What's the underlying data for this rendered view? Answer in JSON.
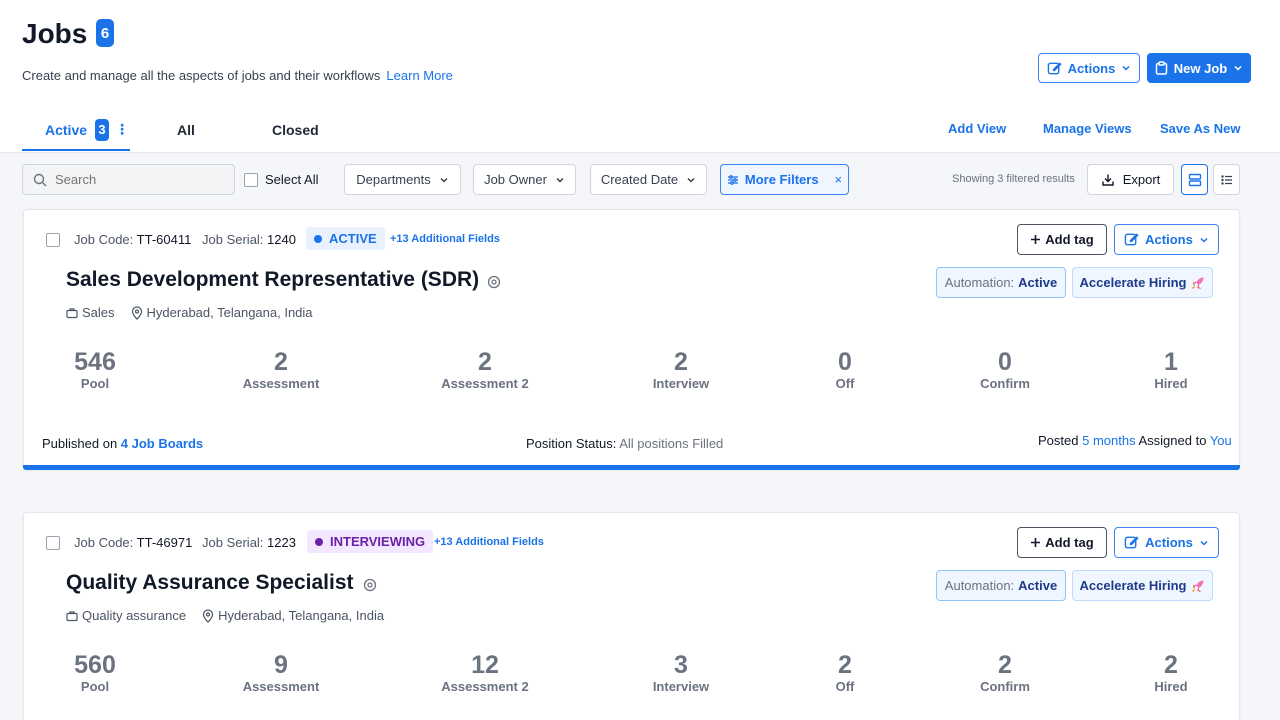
{
  "header": {
    "title": "Jobs",
    "count": "6",
    "subtitle": "Create and manage all the aspects of jobs and their workflows",
    "learn_more": "Learn More",
    "actions_label": "Actions",
    "new_job_label": "New Job"
  },
  "tabs": [
    {
      "label": "Active",
      "count": "3"
    },
    {
      "label": "All"
    },
    {
      "label": "Closed"
    }
  ],
  "views": {
    "add_view": "Add View",
    "manage_views": "Manage Views",
    "save_as_new": "Save As New"
  },
  "filters": {
    "search_placeholder": "Search",
    "select_all": "Select All",
    "departments": "Departments",
    "job_owner": "Job Owner",
    "created_date": "Created Date",
    "more_filters": "More Filters",
    "clear": "×",
    "showing": "Showing 3 filtered results",
    "export": "Export"
  },
  "jobs": [
    {
      "job_code_label": "Job Code:",
      "job_code": "TT-60411",
      "job_serial_label": "Job Serial:",
      "job_serial": "1240",
      "status": "ACTIVE",
      "status_color": "#1a73e8",
      "status_bg": "#e8f1fd",
      "additional_fields": "+13 Additional Fields",
      "add_tag": "Add tag",
      "actions": "Actions",
      "title": "Sales Development Representative (SDR)",
      "automation_label": "Automation:",
      "automation_value": "Active",
      "accelerate": "Accelerate Hiring",
      "department": "Sales",
      "location": "Hyderabad, Telangana, India",
      "stats": [
        {
          "value": "546",
          "label": "Pool"
        },
        {
          "value": "2",
          "label": "Assessment"
        },
        {
          "value": "2",
          "label": "Assessment 2"
        },
        {
          "value": "2",
          "label": "Interview"
        },
        {
          "value": "0",
          "label": "Off"
        },
        {
          "value": "0",
          "label": "Confirm"
        },
        {
          "value": "1",
          "label": "Hired"
        }
      ],
      "published_prefix": "Published on",
      "published_link": "4 Job Boards",
      "position_status_label": "Position Status:",
      "position_status": "All positions Filled",
      "posted_label": "Posted",
      "posted_time": "5 months",
      "assigned_label": "Assigned to",
      "assigned_to": "You"
    },
    {
      "job_code_label": "Job Code:",
      "job_code": "TT-46971",
      "job_serial_label": "Job Serial:",
      "job_serial": "1223",
      "status": "INTERVIEWING",
      "status_color": "#6b21a8",
      "status_bg": "#f3e8ff",
      "additional_fields": "+13 Additional Fields",
      "add_tag": "Add tag",
      "actions": "Actions",
      "title": "Quality Assurance Specialist",
      "automation_label": "Automation:",
      "automation_value": "Active",
      "accelerate": "Accelerate Hiring",
      "department": "Quality assurance",
      "location": "Hyderabad, Telangana, India",
      "stats": [
        {
          "value": "560",
          "label": "Pool"
        },
        {
          "value": "9",
          "label": "Assessment"
        },
        {
          "value": "12",
          "label": "Assessment 2"
        },
        {
          "value": "3",
          "label": "Interview"
        },
        {
          "value": "2",
          "label": "Off"
        },
        {
          "value": "2",
          "label": "Confirm"
        },
        {
          "value": "2",
          "label": "Hired"
        }
      ]
    }
  ]
}
